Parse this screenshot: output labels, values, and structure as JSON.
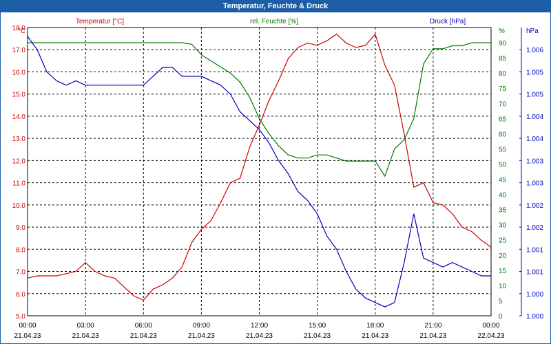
{
  "window": {
    "title": "Temperatur, Feuchte & Druck"
  },
  "colors": {
    "temperature": "#cc0000",
    "humidity": "#007700",
    "pressure": "#0000bb",
    "titlebar": "#1b5ea6"
  },
  "chart_data": {
    "type": "line",
    "title": "Temperatur, Feuchte & Druck",
    "grid": true,
    "legend": "top",
    "x": {
      "range": [
        "21.04.23 00:00",
        "22.04.23 00:00"
      ],
      "ticks": [
        {
          "time": "00:00",
          "date": "21.04.23"
        },
        {
          "time": "03:00",
          "date": "21.04.23"
        },
        {
          "time": "06:00",
          "date": "21.04.23"
        },
        {
          "time": "09:00",
          "date": "21.04.23"
        },
        {
          "time": "12:00",
          "date": "21.04.23"
        },
        {
          "time": "15:00",
          "date": "21.04.23"
        },
        {
          "time": "18:00",
          "date": "21.04.23"
        },
        {
          "time": "21:00",
          "date": "21.04.23"
        },
        {
          "time": "00:00",
          "date": "22.04.23"
        }
      ]
    },
    "axes": {
      "temperature": {
        "label": "Temperatur [°C]",
        "unit": "°C",
        "min": 5,
        "max": 18,
        "ticks": [
          "5.0",
          "6.0",
          "7.0",
          "8.0",
          "9.0",
          "10.0",
          "11.0",
          "12.0",
          "13.0",
          "14.0",
          "15.0",
          "16.0",
          "17.0",
          "18.0"
        ]
      },
      "humidity": {
        "label": "rel. Feuchte [%]",
        "unit": "%",
        "min": 0,
        "max": 95,
        "ticks": [
          "0",
          "5",
          "10",
          "15",
          "20",
          "25",
          "30",
          "35",
          "40",
          "45",
          "50",
          "55",
          "60",
          "65",
          "70",
          "75",
          "80",
          "85",
          "90"
        ]
      },
      "pressure": {
        "label": "Druck [hPa]",
        "unit": "hPa",
        "min": 1000.0,
        "max": 1006.5,
        "ticks": [
          "1.000",
          "1.000",
          "1.001",
          "1.001",
          "1.002",
          "1.002",
          "1.003",
          "1.003",
          "1.004",
          "1.004",
          "1.005",
          "1.005",
          "1.006"
        ]
      }
    },
    "series": [
      {
        "name": "Temperatur [°C]",
        "axis": "temperature",
        "color": "#cc0000",
        "hours": [
          0,
          0.5,
          1,
          1.5,
          2,
          2.5,
          3,
          3.5,
          4,
          4.5,
          5,
          5.5,
          6,
          6.5,
          7,
          7.5,
          8,
          8.5,
          9,
          9.5,
          10,
          10.5,
          11,
          11.5,
          12,
          12.5,
          13,
          13.5,
          14,
          14.5,
          15,
          15.5,
          16,
          16.5,
          17,
          17.5,
          18,
          18.5,
          19,
          19.5,
          20,
          20.5,
          21,
          21.5,
          22,
          22.5,
          23,
          23.5,
          24
        ],
        "values": [
          6.7,
          6.8,
          6.8,
          6.8,
          6.9,
          7.0,
          7.4,
          7.0,
          6.8,
          6.7,
          6.3,
          5.9,
          5.7,
          6.2,
          6.4,
          6.7,
          7.2,
          8.3,
          8.9,
          9.3,
          10.1,
          11.0,
          11.2,
          12.6,
          13.6,
          14.7,
          15.6,
          16.6,
          17.1,
          17.3,
          17.2,
          17.4,
          17.7,
          17.3,
          17.1,
          17.2,
          17.7,
          16.3,
          15.4,
          13.2,
          10.8,
          11.0,
          10.1,
          10.0,
          9.6,
          9.0,
          8.8,
          8.4,
          8.1
        ]
      },
      {
        "name": "rel. Feuchte [%]",
        "axis": "humidity",
        "color": "#007700",
        "hours": [
          0,
          0.5,
          1,
          1.5,
          2,
          2.5,
          3,
          3.5,
          4,
          4.5,
          5,
          5.5,
          6,
          6.5,
          7,
          7.5,
          8,
          8.5,
          9,
          9.5,
          10,
          10.5,
          11,
          11.5,
          12,
          12.5,
          13,
          13.5,
          14,
          14.5,
          15,
          15.5,
          16,
          16.5,
          17,
          17.5,
          18,
          18.5,
          19,
          19.5,
          20,
          20.5,
          21,
          21.5,
          22,
          22.5,
          23,
          23.5,
          24
        ],
        "values": [
          90,
          90,
          90,
          90,
          90,
          90,
          90,
          90,
          90,
          90,
          90,
          90,
          90,
          90,
          90,
          90,
          90,
          89.5,
          86,
          84,
          82,
          80,
          77,
          72,
          65,
          60,
          56,
          53,
          52,
          52,
          53,
          53,
          52,
          51,
          51,
          51,
          51,
          46,
          55,
          58,
          65,
          83,
          88,
          88,
          89,
          89,
          90,
          90,
          90
        ]
      },
      {
        "name": "Druck [hPa]",
        "axis": "pressure",
        "color": "#0000bb",
        "hours": [
          0,
          0.5,
          1,
          1.5,
          2,
          2.5,
          3,
          3.5,
          4,
          4.5,
          5,
          5.5,
          6,
          6.5,
          7,
          7.5,
          8,
          8.5,
          9,
          9.5,
          10,
          10.5,
          11,
          11.5,
          12,
          12.5,
          13,
          13.5,
          14,
          14.5,
          15,
          15.5,
          16,
          16.5,
          17,
          17.5,
          18,
          18.5,
          19,
          19.5,
          20,
          20.5,
          21,
          21.5,
          22,
          22.5,
          23,
          23.5,
          24
        ],
        "values": [
          1006.3,
          1006.0,
          1005.5,
          1005.3,
          1005.2,
          1005.3,
          1005.2,
          1005.2,
          1005.2,
          1005.2,
          1005.2,
          1005.2,
          1005.2,
          1005.4,
          1005.6,
          1005.6,
          1005.4,
          1005.4,
          1005.4,
          1005.3,
          1005.2,
          1005.0,
          1004.6,
          1004.4,
          1004.2,
          1003.9,
          1003.5,
          1003.2,
          1002.8,
          1002.6,
          1002.3,
          1001.8,
          1001.5,
          1001.0,
          1000.6,
          1000.4,
          1000.3,
          1000.2,
          1000.3,
          1001.2,
          1002.3,
          1001.3,
          1001.2,
          1001.1,
          1001.2,
          1001.1,
          1001.0,
          1000.9,
          1000.9
        ]
      }
    ]
  }
}
